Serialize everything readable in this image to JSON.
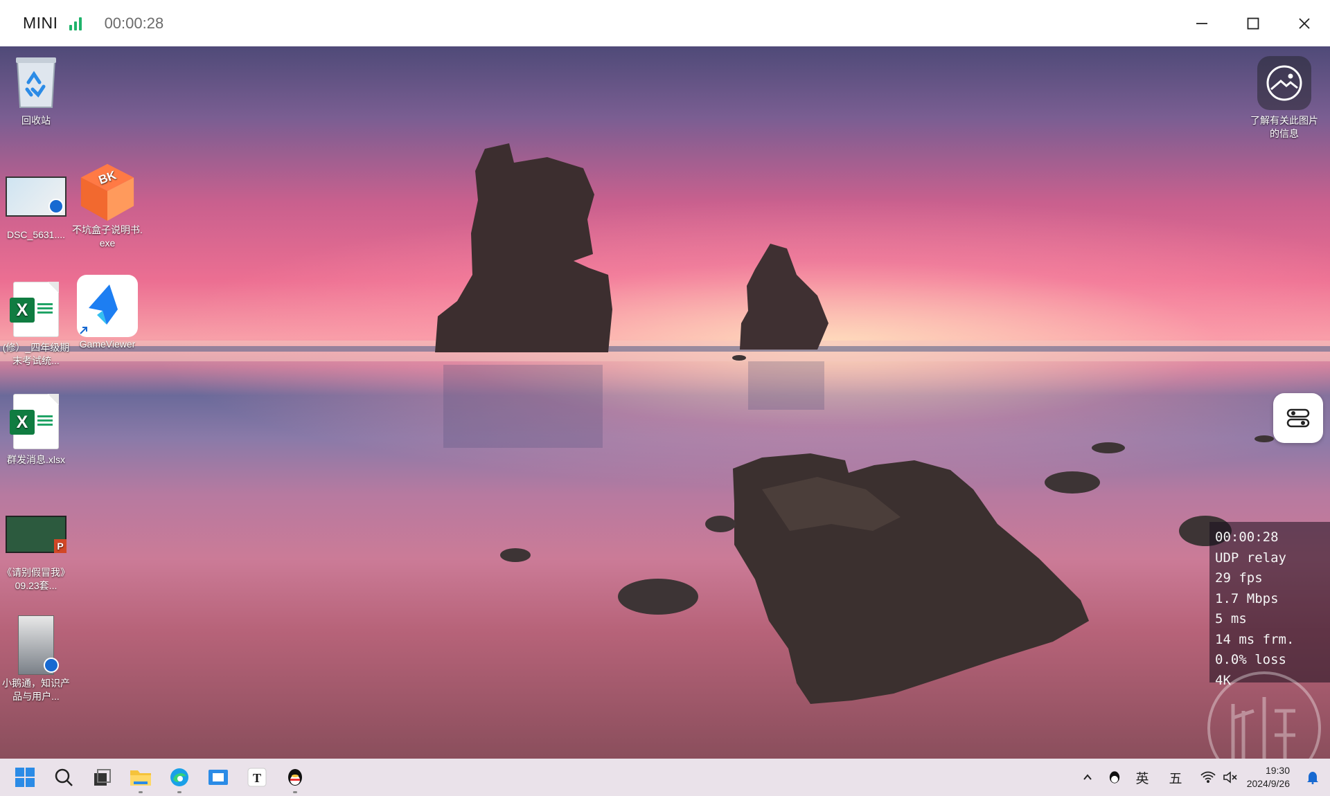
{
  "titlebar": {
    "app_name": "MINI",
    "timer": "00:00:28",
    "signal_icon": "signal-bars-icon",
    "signal_color": "#1fb36b"
  },
  "window_controls": [
    "minimize-icon",
    "maximize-icon",
    "close-icon"
  ],
  "desktop_icons": [
    {
      "label": "回收站",
      "icon": "recycle-bin-icon"
    },
    {
      "label": "DSC_5631....",
      "icon": "video-thumbnail-icon"
    },
    {
      "label": "不坑盒子说明书.exe",
      "icon": "bk-box-app-icon"
    },
    {
      "label": "(修）_四年级期末考试统...",
      "icon": "excel-file-icon"
    },
    {
      "label": "GameViewer",
      "icon": "gameviewer-app-icon"
    },
    {
      "label": "群发消息.xlsx",
      "icon": "excel-file-icon"
    },
    {
      "label": "《请别假冒我》09.23套...",
      "icon": "powerpoint-file-icon"
    },
    {
      "label": "小鹅通，知识产品与用户...",
      "icon": "video-file-icon"
    }
  ],
  "right_panel": {
    "learn_more_label": "了解有关此图片的信息",
    "learn_more_icon": "image-info-icon",
    "toggle_icon": "toggle-settings-icon"
  },
  "stats": {
    "time": "00:00:28",
    "mode": "UDP relay",
    "fps": "29 fps",
    "bitrate": "1.7 Mbps",
    "latency": "5 ms",
    "frame": "14 ms frm.",
    "loss": "0.0% loss",
    "resolution": "4K"
  },
  "taskbar": {
    "items": [
      "windows-start-icon",
      "search-icon",
      "task-view-icon",
      "file-explorer-icon",
      "edge-browser-icon",
      "store-icon",
      "typora-icon",
      "qq-icon"
    ],
    "tray": {
      "chevron": "chevron-up-icon",
      "qq_tray": "qq-icon",
      "ime_lang": "英",
      "ime_mode": "五",
      "wifi": "wifi-icon",
      "volume": "volume-muted-icon",
      "notification": "bell-icon"
    },
    "time": "19:30",
    "date": "2024/9/26"
  },
  "colors": {
    "excel_green": "#107c41",
    "accent_blue": "#1769d1",
    "taskbar_bg": "#eae2ea"
  }
}
